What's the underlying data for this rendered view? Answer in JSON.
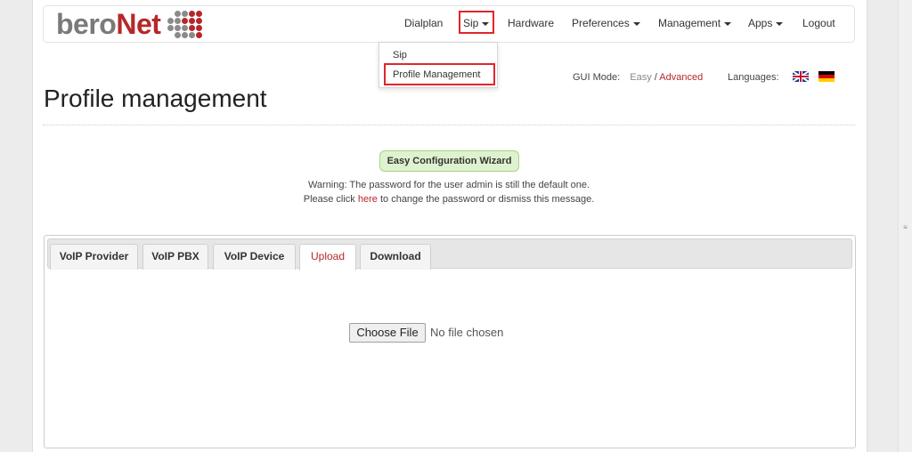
{
  "brand": {
    "name_part1": "bero",
    "name_part2": "Net"
  },
  "nav": {
    "dialplan": "Dialplan",
    "sip": "Sip",
    "hardware": "Hardware",
    "preferences": "Preferences",
    "management": "Management",
    "apps": "Apps",
    "logout": "Logout"
  },
  "dropdown": {
    "items": [
      "Sip",
      "Profile Management"
    ]
  },
  "gui_mode": {
    "label": "GUI Mode:",
    "easy": "Easy",
    "separator": "/",
    "advanced": "Advanced"
  },
  "languages": {
    "label": "Languages:"
  },
  "page": {
    "title": "Profile management"
  },
  "wizard": {
    "label": "Easy Configuration Wizard"
  },
  "warning": {
    "line1": "Warning: The password for the user admin is still the default one.",
    "line2_pre": "Please click",
    "line2_link": "here",
    "line2_post": "to change the password or dismiss this message."
  },
  "tabs": [
    "VoIP Provider",
    "VoIP PBX",
    "VoIP Device",
    "Upload",
    "Download"
  ],
  "active_tab": "Upload",
  "upload": {
    "button": "Choose File",
    "status": "No file chosen"
  },
  "colors": {
    "brand_red": "#b5282a",
    "highlight_red": "#e0262b",
    "wizard_green": "#dff2cf"
  }
}
